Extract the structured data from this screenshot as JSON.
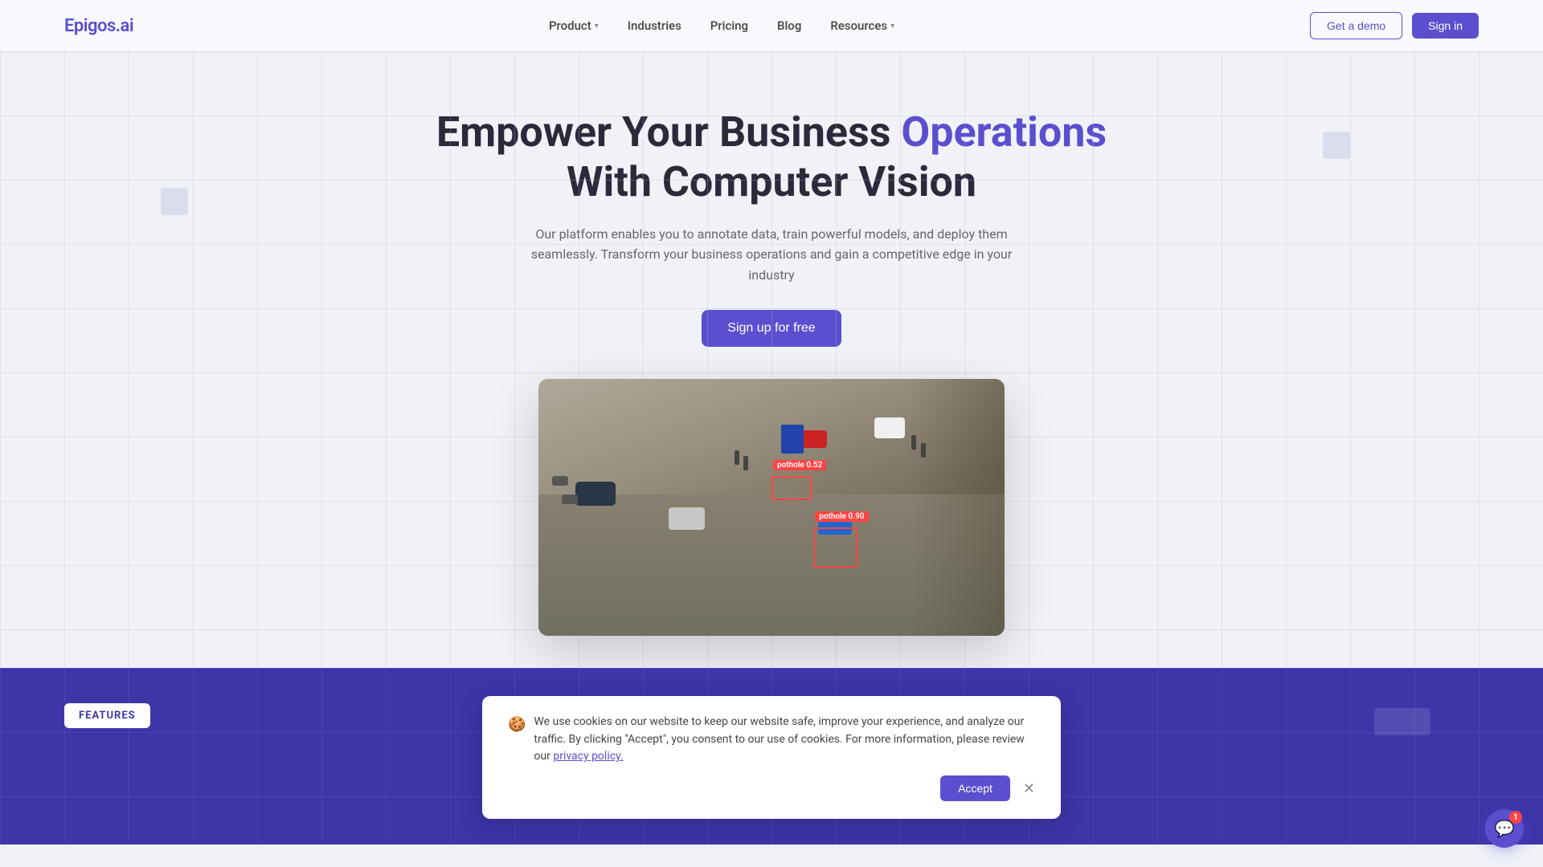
{
  "brand": {
    "logo": "Epigos.ai",
    "logo_plain": "Epigos",
    "logo_accent": ".ai"
  },
  "nav": {
    "links": [
      {
        "label": "Product",
        "has_dropdown": true
      },
      {
        "label": "Industries",
        "has_dropdown": false
      },
      {
        "label": "Pricing",
        "has_dropdown": false
      },
      {
        "label": "Blog",
        "has_dropdown": false
      },
      {
        "label": "Resources",
        "has_dropdown": true
      }
    ],
    "cta_demo": "Get a demo",
    "cta_signin": "Sign in"
  },
  "hero": {
    "title_part1": "Empower Your Business",
    "title_accent": "Operations",
    "title_part2": "With Computer Vision",
    "subtitle": "Our platform enables you to annotate data, train powerful models, and deploy them seamlessly. Transform your business operations and gain a competitive edge in your industry",
    "cta": "Sign up for free"
  },
  "detections": [
    {
      "label": "pothole  0.52",
      "style": "left:50%;top:38%;width:50px;height:30px;"
    },
    {
      "label": "pothole  0.90",
      "style": "left:59%;top:58%;width:55px;height:50px;"
    }
  ],
  "features": {
    "badge": "FEATURES"
  },
  "cookie": {
    "emoji": "🍪",
    "text_before_link": "We use cookies on our website to keep our website safe, improve your experience, and analyze our traffic. By clicking \"Accept\", you consent to our use of cookies. For more information, please review our ",
    "link_text": "privacy policy.",
    "accept_label": "Accept"
  },
  "chat": {
    "badge_count": "1"
  },
  "colors": {
    "accent": "#5b4fcf",
    "detection": "#ff4444",
    "purple_section": "#3d35a8"
  }
}
